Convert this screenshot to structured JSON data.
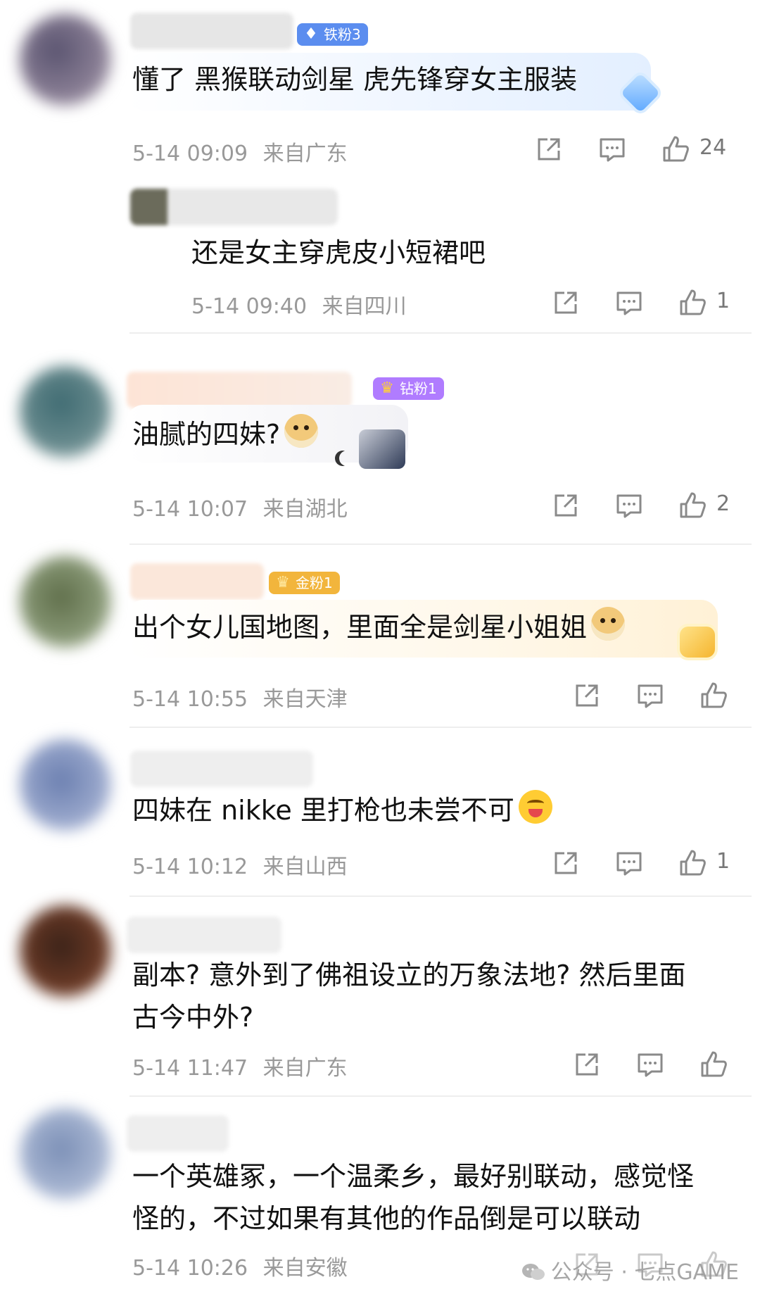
{
  "colors": {
    "timestamp": "#999999",
    "text": "#111111",
    "divider": "#eeeeee",
    "iron_badge": "#5b8def",
    "diamond_badge": "#b07cff",
    "gold_badge": "#f2b53c"
  },
  "icons": [
    "share-icon",
    "reply-icon",
    "like-icon",
    "wechat-icon"
  ],
  "comments": [
    {
      "badge": "铁粉3",
      "badge_icon": "diamond-icon",
      "text": "懂了 黑猴联动剑星 虎先锋穿女主服装",
      "time": "5-14 09:09",
      "location": "来自广东",
      "likes": "24",
      "reply": {
        "text": "还是女主穿虎皮小短裙吧",
        "time": "5-14 09:40",
        "location": "来自四川",
        "likes": "1"
      }
    },
    {
      "badge": "钻粉1",
      "badge_icon": "crown-icon",
      "text": "油腻的四妹?",
      "time": "5-14 10:07",
      "location": "来自湖北",
      "likes": "2"
    },
    {
      "badge": "金粉1",
      "badge_icon": "crown-icon",
      "text": "出个女儿国地图，里面全是剑星小姐姐",
      "time": "5-14 10:55",
      "location": "来自天津",
      "likes": ""
    },
    {
      "text": "四妹在 nikke 里打枪也未尝不可",
      "time": "5-14 10:12",
      "location": "来自山西",
      "likes": "1"
    },
    {
      "text_line1": "副本?  意外到了佛祖设立的万象法地? 然后里面",
      "text_line2": "古今中外?",
      "time": "5-14 11:47",
      "location": "来自广东",
      "likes": ""
    },
    {
      "text_line1": "一个英雄冢，一个温柔乡，最好别联动，感觉怪",
      "text_line2": "怪的，不过如果有其他的作品倒是可以联动",
      "time": "5-14 10:26",
      "location": "来自安徽",
      "likes": ""
    }
  ],
  "watermark": "公众号 · 七点GAME"
}
